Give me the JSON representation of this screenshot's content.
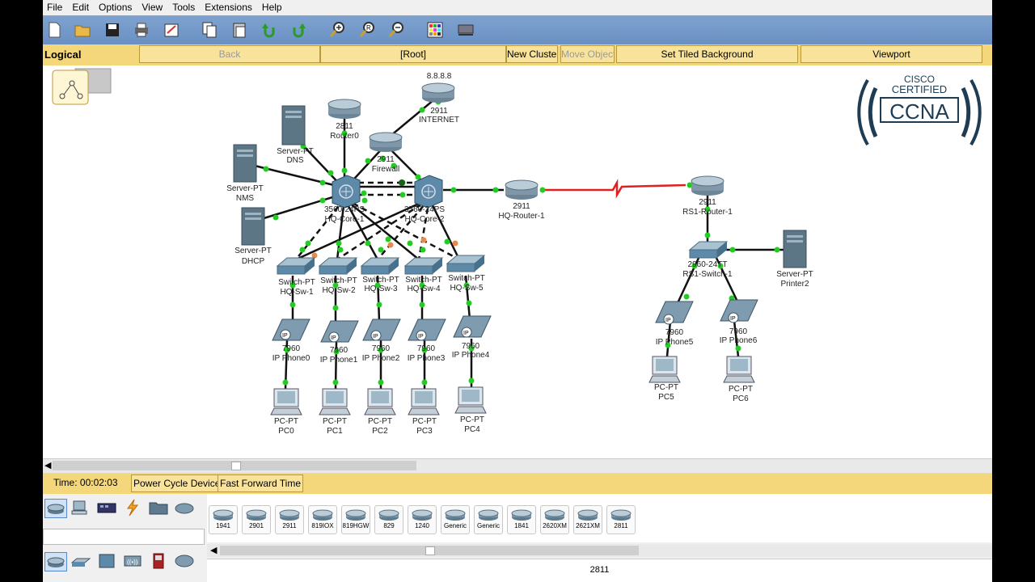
{
  "menu": [
    "File",
    "Edit",
    "Options",
    "View",
    "Tools",
    "Extensions",
    "Help"
  ],
  "toolbar": {
    "icons": [
      "new-icon",
      "open-icon",
      "save-icon",
      "print-icon",
      "activity-wizard-icon",
      "copy-icon",
      "paste-icon",
      "undo-icon",
      "redo-icon",
      "zoom-in-icon",
      "zoom-reset-icon",
      "zoom-out-icon",
      "palette-icon",
      "custom-device-icon"
    ]
  },
  "nav": {
    "logical": "Logical",
    "back": "Back",
    "root": "[Root]",
    "new_cluster": "New Cluster",
    "move_object": "Move Object",
    "tiled_bg": "Set Tiled Background",
    "viewport": "Viewport"
  },
  "badge": {
    "line1": "CISCO",
    "line2": "CERTIFIED",
    "line3": "CCNA"
  },
  "devices": {
    "internet_ip": "8.8.8.8",
    "internet_model": "2911",
    "internet_name": "INTERNET",
    "router0_model": "2811",
    "router0_name": "Router0",
    "firewall_model": "2911",
    "firewall_name": "Firewall",
    "dns_model": "Server-PT",
    "dns_name": "DNS",
    "nms_model": "Server-PT",
    "nms_name": "NMS",
    "dhcp_model": "Server-PT",
    "dhcp_name": "DHCP",
    "core1_model": "3560-24PS",
    "core1_name": "HQ-Core-1",
    "core2_model": "3560-24PS",
    "core2_name": "HQ-Core-2",
    "hqr_model": "2911",
    "hqr_name": "HQ-Router-1",
    "rs1r_model": "2911",
    "rs1r_name": "RS1-Router-1",
    "rs1sw_model": "2960-24TT",
    "rs1sw_name": "RS1-Switch-1",
    "printer_model": "Server-PT",
    "printer_name": "Printer2",
    "switch_model": "Switch-PT",
    "sw1": "HQ-Sw-1",
    "sw2": "HQ-Sw-2",
    "sw3": "HQ-Sw-3",
    "sw4": "HQ-Sw-4",
    "sw5": "HQ-Sw-5",
    "phone_model": "7960",
    "ph0": "IP Phone0",
    "ph1": "IP Phone1",
    "ph2": "IP Phone2",
    "ph3": "IP Phone3",
    "ph4": "IP Phone4",
    "ph5": "IP Phone5",
    "ph6": "IP Phone6",
    "pc_model": "PC-PT",
    "pc0": "PC0",
    "pc1": "PC1",
    "pc2": "PC2",
    "pc3": "PC3",
    "pc4": "PC4",
    "pc5": "PC5",
    "pc6": "PC6"
  },
  "status": {
    "time": "Time: 00:02:03",
    "power_cycle": "Power Cycle Devices",
    "fast_forward": "Fast Forward Time"
  },
  "categories_top": [
    "network-devices-icon",
    "end-devices-icon",
    "components-icon",
    "connections-icon",
    "misc-icon",
    "multiuser-icon"
  ],
  "categories_bottom": [
    "routers-icon",
    "switches-icon",
    "hubs-icon",
    "wireless-icon",
    "security-icon",
    "wan-emulation-icon"
  ],
  "device_list": [
    "1941",
    "2901",
    "2911",
    "819IOX",
    "819HGW",
    "829",
    "1240",
    "Generic",
    "Generic",
    "1841",
    "2620XM",
    "2621XM",
    "2811"
  ],
  "selected_model": "2811",
  "colors": {
    "link_green": "#22cc22",
    "link_orange": "#e88a4a",
    "serial_red": "#e02020",
    "toolbar_blue": "#7fa3d0",
    "nav_yellow": "#f4d77b"
  }
}
